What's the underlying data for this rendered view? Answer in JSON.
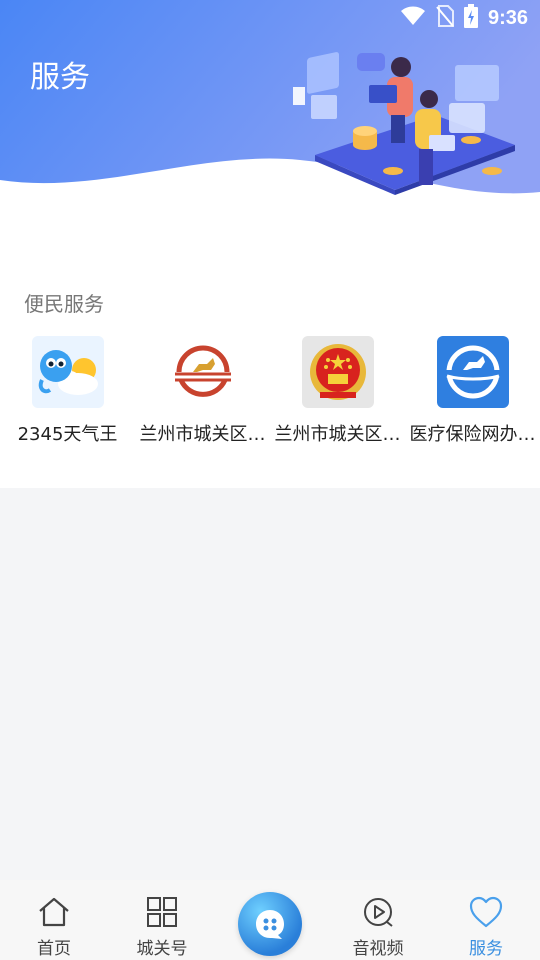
{
  "status_bar": {
    "time": "9:36"
  },
  "header": {
    "title": "服务"
  },
  "section": {
    "title": "便民服务"
  },
  "services": [
    {
      "label": "2345天气王",
      "icon": "weather-app-icon"
    },
    {
      "label": "兰州市城关区…",
      "icon": "horse-logo-icon"
    },
    {
      "label": "兰州市城关区…",
      "icon": "national-emblem-icon"
    },
    {
      "label": "医疗保险网办…",
      "icon": "medical-insurance-icon"
    }
  ],
  "bottom_nav": {
    "items": [
      {
        "label": "首页",
        "icon": "home-icon"
      },
      {
        "label": "城关号",
        "icon": "grid-icon"
      },
      {
        "label": "",
        "icon": "chat-bubble-icon"
      },
      {
        "label": "音视频",
        "icon": "play-icon"
      },
      {
        "label": "服务",
        "icon": "heart-icon"
      }
    ],
    "active_index": 4
  },
  "colors": {
    "accent": "#3a8fe0",
    "header_start": "#4a8cf6",
    "header_end": "#8aa2f6"
  }
}
